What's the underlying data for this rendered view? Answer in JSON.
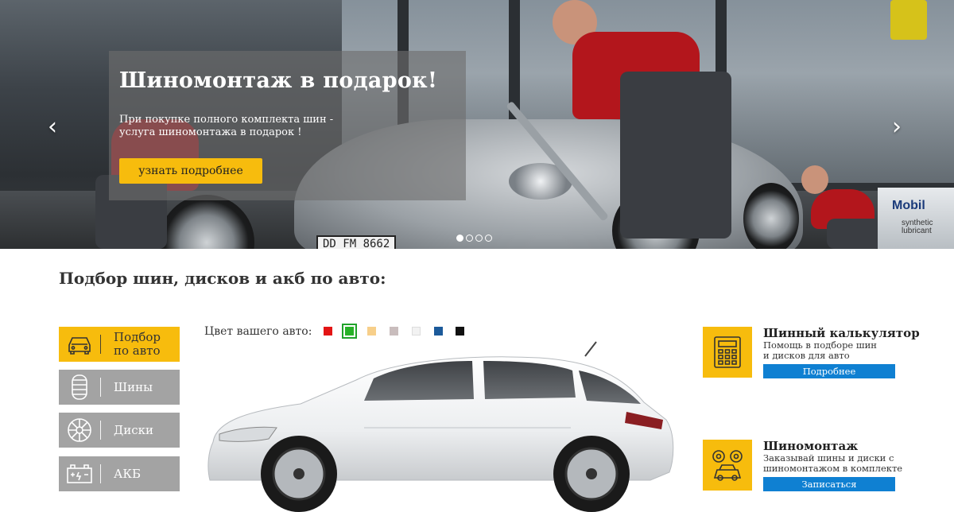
{
  "slider": {
    "title": "Шиномонтаж в подарок!",
    "description": "При покупке полного комплекта шин - услуга шиномонтажа в подарок !",
    "cta_label": "узнать подробнее",
    "plate_text": "DD FM 8662",
    "brand_sign": {
      "name": "Mobil",
      "sub_line1": "synthetic",
      "sub_line2": "lubricant"
    },
    "prev_arrow": "‹",
    "next_arrow": "›",
    "slide_count": 4,
    "active_slide": 1
  },
  "section": {
    "title": "Подбор шин, дисков и акб по авто:"
  },
  "nav": {
    "items": [
      {
        "label": "Подбор по авто",
        "icon": "car-icon",
        "active": true
      },
      {
        "label": "Шины",
        "icon": "tire-icon",
        "active": false
      },
      {
        "label": "Диски",
        "icon": "rim-icon",
        "active": false
      },
      {
        "label": "АКБ",
        "icon": "battery-icon",
        "active": false
      }
    ]
  },
  "color_picker": {
    "label": "Цвет вашего авто:",
    "colors": [
      "#e31414",
      "#27b127",
      "#f7cf8a",
      "#c9bdbd",
      "#f2f2f2",
      "#1c5a9a",
      "#111111"
    ],
    "selected": 1
  },
  "promos": {
    "calculator": {
      "title": "Шинный калькулятор",
      "text": "Помощь в подборе шин и дисков для авто",
      "button": "Подробнее",
      "icon": "calculator-icon"
    },
    "service": {
      "title": "Шиномонтаж",
      "text": "Заказывай шины и диски с шиномонтажом в комплекте",
      "button": "Записаться",
      "icon": "car-service-icon"
    }
  },
  "colors": {
    "accent": "#f7bc0d",
    "nav_inactive": "#a3a3a3",
    "button_blue": "#0f80d2"
  }
}
